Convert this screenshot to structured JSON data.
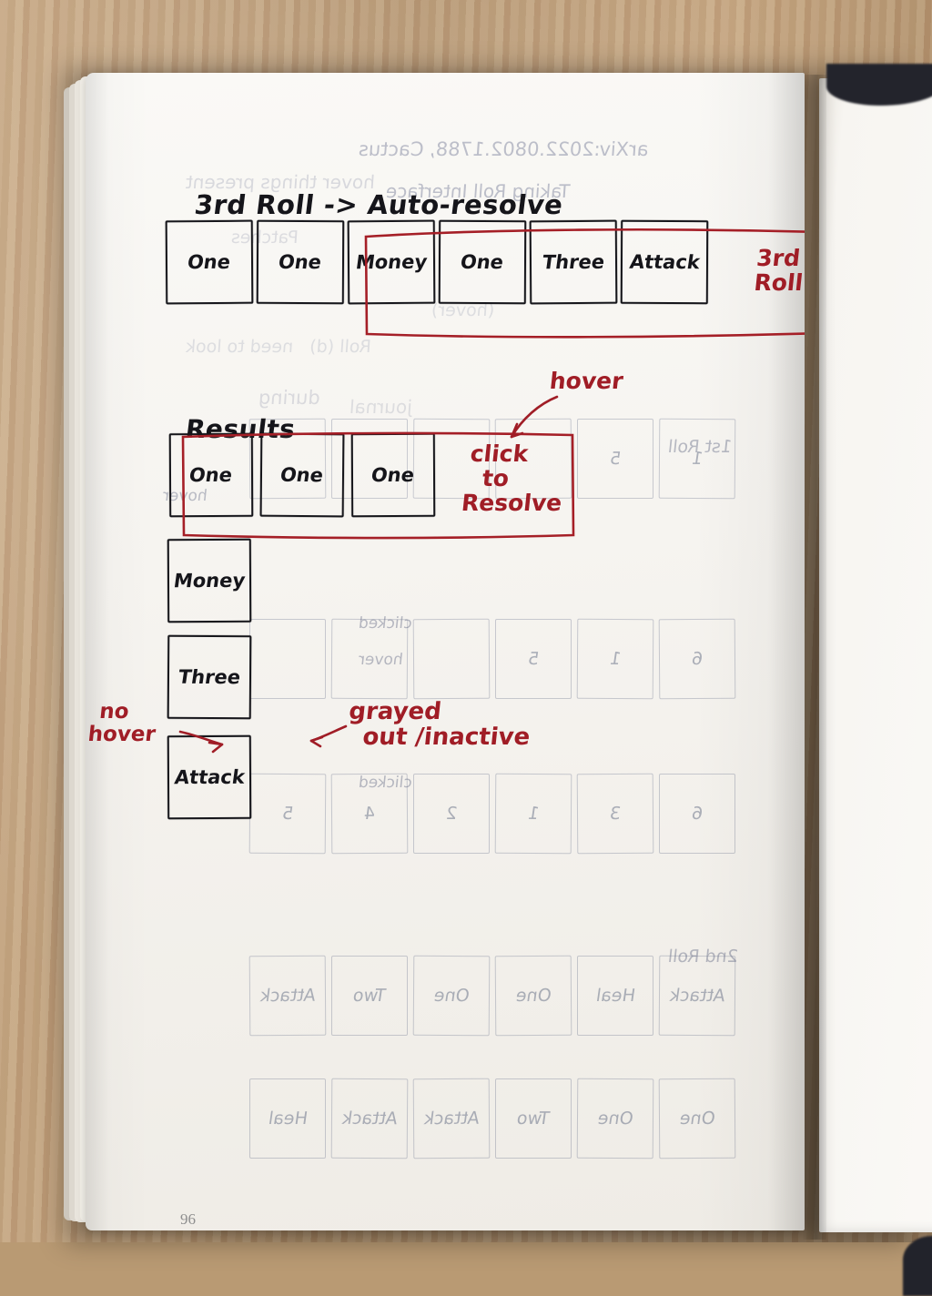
{
  "scene": {
    "surface": "wooden-desk",
    "object": "open-notebook",
    "page_number": "96"
  },
  "sketch": {
    "title": "3rd Roll -> Auto-resolve",
    "results_label": "Results",
    "dice_row": {
      "cells": [
        "One",
        "One",
        "Money",
        "One",
        "Three",
        "Attack"
      ],
      "highlight_label": "3rd Roll",
      "highlight_from_index": 2
    },
    "results_row": {
      "cells": [
        "One",
        "One",
        "One"
      ],
      "callout": "Click\nto\nResolve",
      "callout_line1": "click",
      "callout_line2": "to",
      "callout_line3": "Resolve",
      "hover_label": "hover"
    },
    "results_column": {
      "cells": [
        "Money",
        "Three",
        "Attack"
      ],
      "no_hover_label_line1": "no",
      "no_hover_label_line2": "hover",
      "grayed_label_line1": "grayed",
      "grayed_label_line2": "out /inactive"
    },
    "colors": {
      "ink": "#15151a",
      "annotation_red": "#a21f28",
      "paper": "#f7f5f1",
      "desk": "#c09f78",
      "binding": "#23242c"
    }
  },
  "bleed_through": {
    "description": "faint mirrored writing showing through from the reverse side of the page",
    "top_text_line1": "arXiv:2022.0802.1788, Cactus",
    "top_text_line2": "Taking Roll Interface",
    "labels": [
      "1st Roll",
      "2nd Roll"
    ],
    "rows": [
      {
        "cells": [
          "",
          "",
          "",
          "",
          "5",
          "1"
        ]
      },
      {
        "cells": [
          "",
          "",
          "",
          "5",
          "1",
          "6"
        ]
      },
      {
        "cells": [
          "5",
          "4",
          "2",
          "1",
          "3",
          "6"
        ]
      },
      {
        "cells": [
          "Attack",
          "Two",
          "One",
          "One",
          "Heal",
          "Attack"
        ]
      },
      {
        "cells": [
          "Heal",
          "Attack",
          "Attack",
          "Two",
          "One",
          "One"
        ]
      }
    ]
  }
}
